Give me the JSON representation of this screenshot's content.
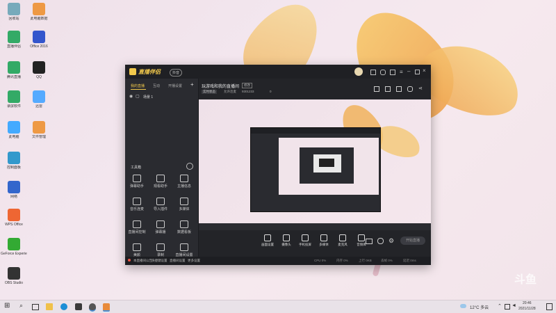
{
  "desktop": {
    "icons": [
      {
        "label": "回收站",
        "color": "#7ab"
      },
      {
        "label": "此电脑数据",
        "color": "#e94"
      },
      {
        "label": "直播伴侣",
        "color": "#3a6"
      },
      {
        "label": "Office 2016",
        "color": "#35c"
      },
      {
        "label": "腾讯直播",
        "color": "#3a6"
      },
      {
        "label": "QQ",
        "color": "#222"
      },
      {
        "label": "录屏软件",
        "color": "#3a6"
      },
      {
        "label": "迅雷",
        "color": "#5af"
      },
      {
        "label": "此电脑",
        "color": "#4af"
      },
      {
        "label": "文件管理",
        "color": "#e94"
      },
      {
        "label": "控制面板",
        "color": "#39c"
      },
      {
        "label": "网络",
        "color": "#36c"
      },
      {
        "label": "WPS Office",
        "color": "#e63"
      },
      {
        "label": "GeForce Experience",
        "color": "#3a3"
      },
      {
        "label": "OBS Studio",
        "color": "#333"
      }
    ]
  },
  "app": {
    "title": "直播伴侣",
    "badge": "抖音",
    "left_tabs": [
      "我的直播",
      "互动",
      "开播设置"
    ],
    "scene_label": "场景 1",
    "tools_header": "工具箱",
    "tools": [
      {
        "label": "弹幕助手"
      },
      {
        "label": "观看助手"
      },
      {
        "label": "主播信息"
      },
      {
        "label": "音乐连麦"
      },
      {
        "label": "导入插件"
      },
      {
        "label": "多媒体"
      },
      {
        "label": "直播间控制"
      },
      {
        "label": "弹幕播"
      },
      {
        "label": "数据看板"
      },
      {
        "label": "美颜"
      },
      {
        "label": "录制"
      },
      {
        "label": "直播间设置"
      }
    ],
    "room_title": "玩游戏和我的直播间",
    "room_tag": "修改",
    "room_meta": [
      "实时状态",
      "允许连麦",
      "9301233",
      "0"
    ],
    "bottom_tools": [
      "画面设置",
      "摄像头",
      "手机投屏",
      "多媒体",
      "麦克风",
      "音频库"
    ],
    "start_label": "开始直播",
    "status_left": [
      "本直播间公告",
      "快捷键设置",
      "直播间设置",
      "更多设置"
    ],
    "status_right": [
      "CPU 0%",
      "内存 0%",
      "上行 0KB",
      "丢帧 0%",
      "延迟 0ms"
    ]
  },
  "watermark": "斗鱼",
  "taskbar": {
    "weather": "12°C 多云",
    "time": "20:46",
    "date": "2021/11/28"
  }
}
